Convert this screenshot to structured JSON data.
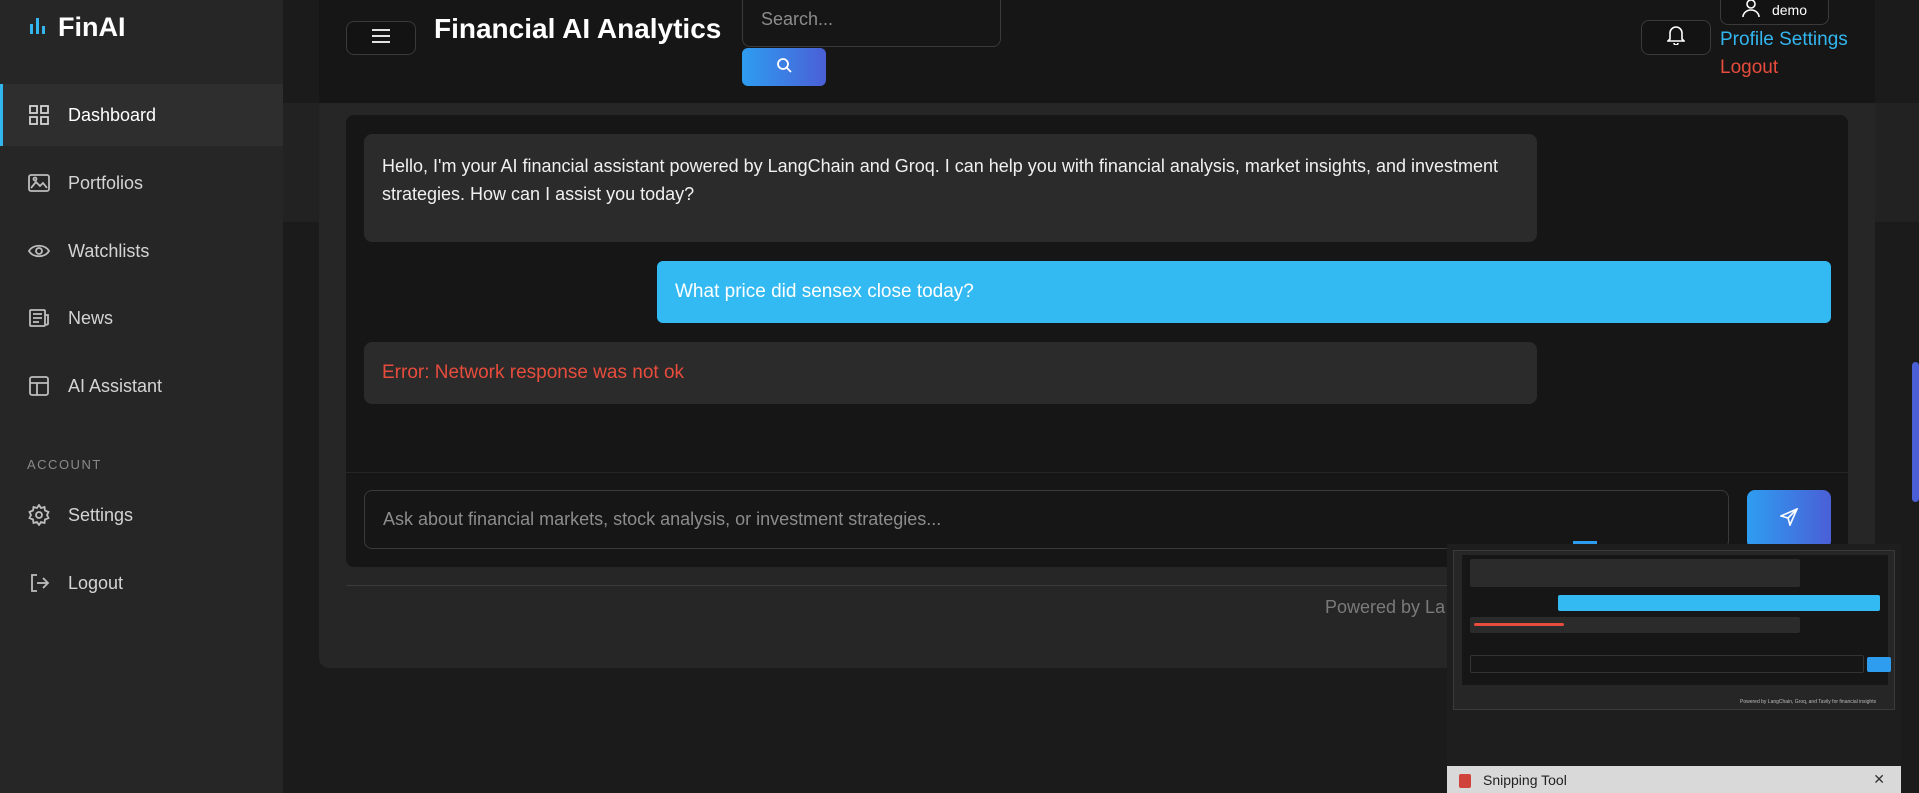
{
  "sidebar": {
    "brand": "FinAI",
    "nav_items": [
      {
        "label": "Dashboard",
        "icon": "grid-icon",
        "active": true
      },
      {
        "label": "Portfolios",
        "icon": "image-icon"
      },
      {
        "label": "Watchlists",
        "icon": "eye-icon"
      },
      {
        "label": "News",
        "icon": "newspaper-icon"
      },
      {
        "label": "AI Assistant",
        "icon": "layout-icon"
      }
    ],
    "section_label": "ACCOUNT",
    "account_items": [
      {
        "label": "Settings",
        "icon": "gear-icon"
      },
      {
        "label": "Logout",
        "icon": "logout-icon"
      }
    ]
  },
  "header": {
    "title": "Financial AI Analytics",
    "search_placeholder": "Search...",
    "username": "demo",
    "profile_link": "Profile Settings",
    "logout_link": "Logout"
  },
  "chat": {
    "messages": [
      {
        "role": "assistant",
        "text": "Hello, I'm your AI financial assistant powered by LangChain and Groq. I can help you with financial analysis, market insights, and investment strategies. How can I assist you today?"
      },
      {
        "role": "user",
        "text": "What price did sensex close today?"
      },
      {
        "role": "error",
        "text": "Error: Network response was not ok"
      }
    ],
    "input_placeholder": "Ask about financial markets, stock analysis, or investment strategies...",
    "powered_by": "Powered by La"
  },
  "thumbnail_popup": {
    "footer_title": "Snipping Tool",
    "preview_powered": "Powered by LangChain, Groq, and Tavily for financial insights"
  },
  "colors": {
    "accent": "#33b6ef",
    "error": "#e74c3c",
    "gradient_start": "#2e9df0",
    "gradient_end": "#4a5fd6"
  }
}
